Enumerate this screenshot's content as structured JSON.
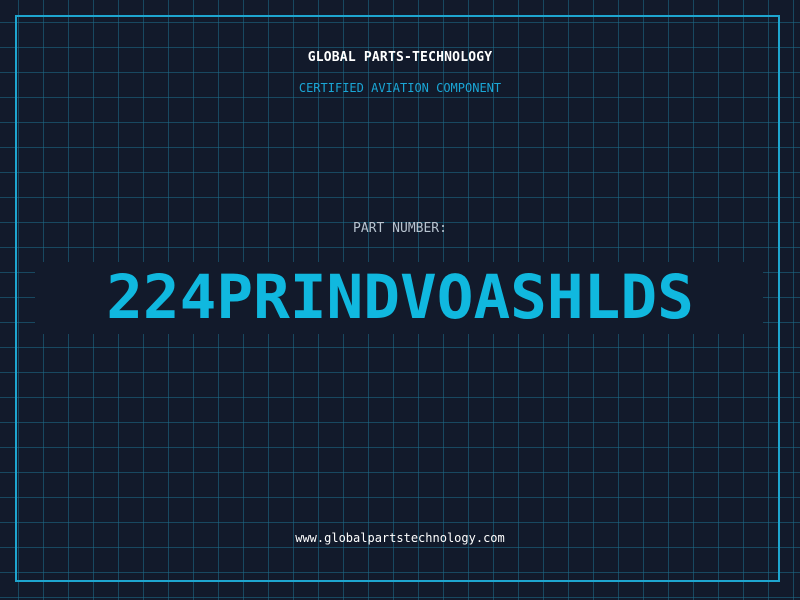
{
  "header": {
    "company_name": "GLOBAL PARTS-TECHNOLOGY",
    "subtitle": "CERTIFIED AVIATION COMPONENT"
  },
  "main": {
    "part_label": "PART NUMBER:",
    "part_number": "224PRINDVOASHLDS"
  },
  "footer": {
    "website": "www.globalpartstechnology.com"
  },
  "colors": {
    "background": "#121a2b",
    "grid": "#1e6e8c",
    "accent": "#10b8df",
    "frame": "#1ea5cf",
    "text_primary": "#ffffff",
    "text_muted": "#b7c3cf"
  }
}
